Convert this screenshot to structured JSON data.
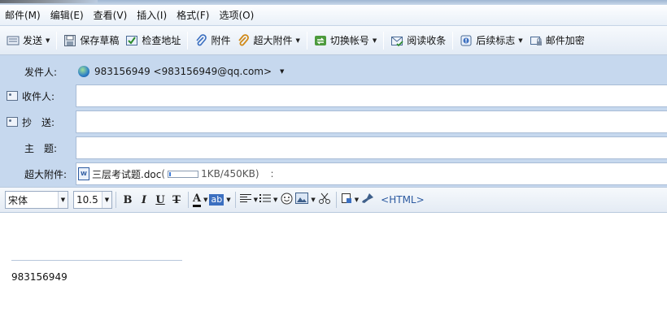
{
  "menu": [
    "邮件(M)",
    "编辑(E)",
    "查看(V)",
    "插入(I)",
    "格式(F)",
    "选项(O)"
  ],
  "toolbar": {
    "send": "发送",
    "save_draft": "保存草稿",
    "check_address": "检查地址",
    "attach": "附件",
    "super_attach": "超大附件",
    "switch_account": "切换帐号",
    "read_receipt": "阅读收条",
    "follow_up": "后续标志",
    "encrypt": "邮件加密"
  },
  "header": {
    "from_label": "发件人:",
    "from_value": "983156949 <983156949@qq.com>",
    "to_label": "收件人:",
    "to_value": "",
    "cc_label": "抄　送:",
    "cc_value": "",
    "subject_label": "主　题:",
    "subject_value": "",
    "super_attach_label": "超大附件:",
    "attachment": {
      "name": "三层考试题.doc",
      "open_paren": "(",
      "progress": 0.05,
      "size": "1KB/450KB)",
      "extra": ":"
    }
  },
  "format": {
    "font": "宋体",
    "size": "10.5",
    "bold": "B",
    "italic": "I",
    "underline": "U",
    "strike": "T",
    "font_color": "A",
    "highlight": "ab",
    "html": "<HTML>"
  },
  "body": {
    "signature": "983156949"
  },
  "colors": {
    "header_bg": "#c6d8ee",
    "accent_blue": "#2c5aa0"
  }
}
